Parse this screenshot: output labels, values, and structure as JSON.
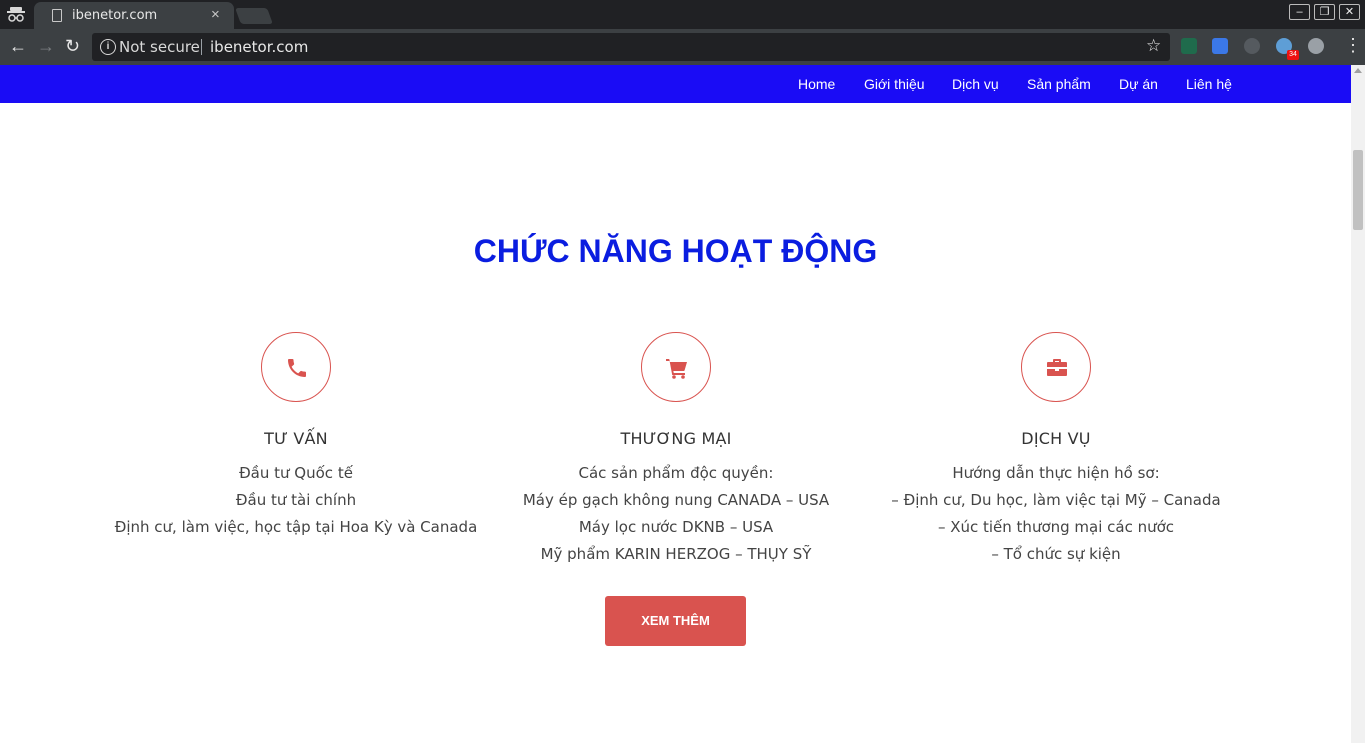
{
  "browser": {
    "tab_title": "ibenetor.com",
    "tab_close": "×",
    "security_label": "Not secure",
    "url": "ibenetor.com",
    "extension_badge": "34"
  },
  "nav": {
    "items": [
      {
        "label": "Home"
      },
      {
        "label": "Giới thiệu"
      },
      {
        "label": "Dịch vụ"
      },
      {
        "label": "Sản phẩm"
      },
      {
        "label": "Dự án"
      },
      {
        "label": "Liên hệ"
      }
    ]
  },
  "section": {
    "title": "CHỨC NĂNG HOẠT ĐỘNG",
    "features": [
      {
        "icon": "phone-icon",
        "title": "TƯ VẤN",
        "lines": [
          "Đầu tư Quốc tế",
          "Đầu tư tài chính",
          "Định cư, làm việc, học tập tại Hoa Kỳ và Canada"
        ]
      },
      {
        "icon": "shopping-cart-icon",
        "title": "THƯƠNG MẠI",
        "lines": [
          "Các sản phẩm độc quyền:",
          "Máy ép gạch không nung CANADA – USA",
          "Máy lọc nước DKNB – USA",
          "Mỹ phẩm KARIN HERZOG – THỤY SỸ"
        ]
      },
      {
        "icon": "briefcase-icon",
        "title": "DỊCH VỤ",
        "lines": [
          "Hướng dẫn thực hiện hồ sơ:",
          "– Định cư, Du học, làm việc tại Mỹ – Canada",
          "– Xúc tiến thương mại các nước",
          "– Tổ chức sự kiện"
        ]
      }
    ],
    "cta_label": "XEM THÊM"
  },
  "colors": {
    "navbar": "#1a0cf5",
    "title": "#0a1de0",
    "accent": "#d9534f"
  }
}
